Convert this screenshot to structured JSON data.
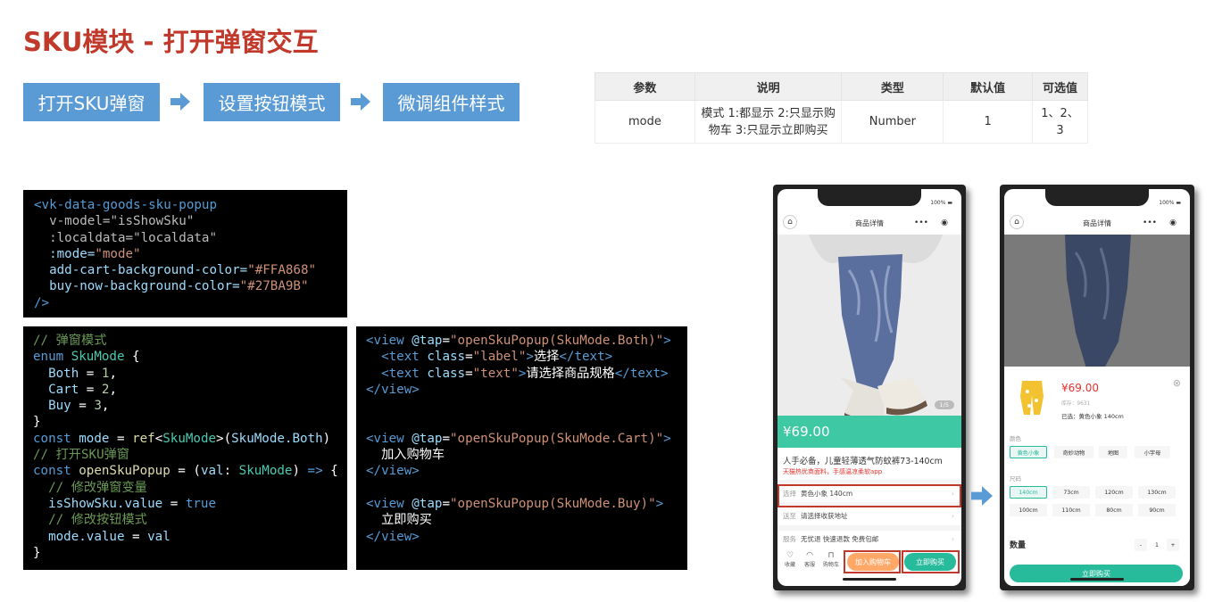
{
  "title": "SKU模块 - 打开弹窗交互",
  "steps": [
    "打开SKU弹窗",
    "设置按钮模式",
    "微调组件样式"
  ],
  "table": {
    "headers": [
      "参数",
      "说明",
      "类型",
      "默认值",
      "可选值"
    ],
    "row": {
      "name": "mode",
      "desc_line1": "模式 1:都显示 2:只显示购",
      "desc_line2": "物车 3:只显示立即购买",
      "type": "Number",
      "default": "1",
      "options": "1、2、3"
    }
  },
  "code1": {
    "tag_open": "<vk-data-goods-sku-popup",
    "l_vmodel_attr": "v-model=",
    "l_vmodel_val": "\"isShowSku\"",
    "l_local_attr": ":localdata=",
    "l_local_val": "\"localdata\"",
    "l_mode_attr": ":mode=",
    "l_mode_val": "\"mode\"",
    "l_cart_attr": "add-cart-background-color=",
    "l_cart_val": "\"#FFA868\"",
    "l_buy_attr": "buy-now-background-color=",
    "l_buy_val": "\"#27BA9B\"",
    "tag_close": "/>"
  },
  "code2": {
    "c1": "// 弹窗模式",
    "enum_kw": "enum",
    "enum_name": "SkuMode",
    "brace_open": " {",
    "both": "Both",
    "cart": "Cart",
    "buy": "Buy",
    "v1": "1",
    "v2": "2",
    "v3": "3",
    "const": "const",
    "mode_var": "mode",
    "ref": "ref",
    "ref_arg": "SkuMode.Both",
    "c2": "// 打开SKU弹窗",
    "open_fn": "openSkuPopup",
    "val": "val",
    "sku_type": "SkuMode",
    "c3": "// 修改弹窗变量",
    "show_line": "isShowSku.value",
    "true_kw": "true",
    "c4": "// 修改按钮模式",
    "mode_line": "mode.value",
    "brace_close": "}"
  },
  "code3": {
    "view": "view",
    "tap": "@tap",
    "call_both": "\"openSkuPopup(SkuMode.Both)\"",
    "text": "text",
    "class": "class",
    "label_cls": "\"label\"",
    "label_txt": "选择",
    "text_cls": "\"text\"",
    "text_txt": "请选择商品规格",
    "call_cart": "\"openSkuPopup(SkuMode.Cart)\"",
    "cart_txt": "加入购物车",
    "call_buy": "\"openSkuPopup(SkuMode.Buy)\"",
    "buy_txt": "立即购买"
  },
  "phone1": {
    "battery": "100%",
    "nav_title": "商品详情",
    "page": "1/5",
    "price": "¥69.00",
    "prod_title": "人手必备，儿童轻薄透气防蚊裤73-140cm",
    "prod_sub": "天猫热优商面料，手感温凉柔软app",
    "row1_lbl": "选择",
    "row1_val": "黄色小象 140cm",
    "row2_lbl": "送至",
    "row2_val": "请选择收获地址",
    "row3_lbl": "服务",
    "row3_val": "无忧退 快速退款 免费包邮",
    "fav": "收藏",
    "service": "客服",
    "cart": "购物车",
    "add_cart": "加入购物车",
    "buy_now": "立即购买"
  },
  "phone2": {
    "battery": "100%",
    "nav_title": "商品详情",
    "price": "¥69.00",
    "stock": "库存：9631",
    "selected": "已选：黄色小象 140cm",
    "color_lbl": "颜色",
    "colors": [
      "黄色小象",
      "奇妙动物",
      "地图",
      "小字母"
    ],
    "size_lbl": "尺码",
    "sizes": [
      "140cm",
      "73cm",
      "120cm",
      "130cm",
      "100cm",
      "110cm",
      "80cm",
      "90cm"
    ],
    "qty_lbl": "数量",
    "qty": "1",
    "minus": "-",
    "plus": "+",
    "buy_now": "立即购买"
  },
  "colors": {
    "title": "#c0392b",
    "step": "#5b9bd5",
    "green": "#3fc8a4",
    "orange": "#ffa868",
    "buy": "#27ba9b"
  }
}
